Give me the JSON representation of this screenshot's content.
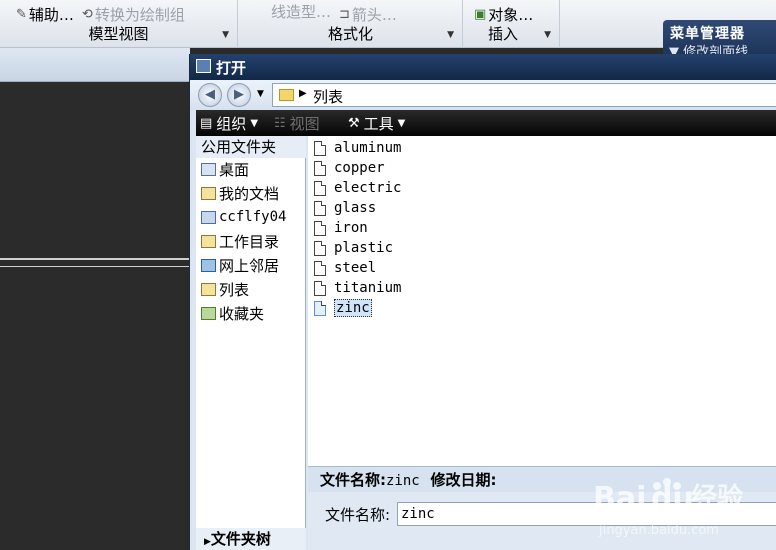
{
  "ribbon": {
    "groups": [
      {
        "title": "模型视图",
        "items": [
          {
            "label": "辅助…",
            "icon": "pencil-icon",
            "enabled": true
          },
          {
            "label": "转换为绘制组",
            "icon": "convert-icon",
            "enabled": false
          }
        ]
      },
      {
        "title": "格式化",
        "items": [
          {
            "label": "线造型…",
            "icon": "line-icon",
            "enabled": false
          },
          {
            "label": "箭头…",
            "icon": "arrow-icon",
            "enabled": false
          }
        ]
      },
      {
        "title": "插入",
        "items": [
          {
            "label": "对象…",
            "icon": "object-icon",
            "enabled": true
          }
        ]
      }
    ]
  },
  "menu_manager": {
    "title": "菜单管理器",
    "item": "修改剖面线"
  },
  "dialog": {
    "title": "打开",
    "address": "列表",
    "toolbar": {
      "organize": "组织",
      "view": "视图",
      "tools": "工具"
    },
    "nav_header": "公用文件夹",
    "nav_items": [
      {
        "label": "桌面",
        "icon": "desktop-icon"
      },
      {
        "label": "我的文档",
        "icon": "documents-folder-icon"
      },
      {
        "label": "ccflfy04",
        "icon": "computer-icon"
      },
      {
        "label": "工作目录",
        "icon": "work-folder-icon"
      },
      {
        "label": "网上邻居",
        "icon": "network-icon"
      },
      {
        "label": "列表",
        "icon": "folder-icon"
      },
      {
        "label": "收藏夹",
        "icon": "favorites-icon"
      }
    ],
    "nav_bottom": "文件夹树",
    "files": [
      "aluminum",
      "copper",
      "electric",
      "glass",
      "iron",
      "plastic",
      "steel",
      "titanium",
      "zinc"
    ],
    "selected_file": "zinc",
    "info": {
      "name_label": "文件名称:",
      "name_value": "zinc",
      "date_label": "修改日期:"
    },
    "filename_label": "文件名称:",
    "filename_value": "zinc"
  },
  "watermark": {
    "brand": "Baidu经验",
    "url": "jingyan.baidu.com"
  }
}
